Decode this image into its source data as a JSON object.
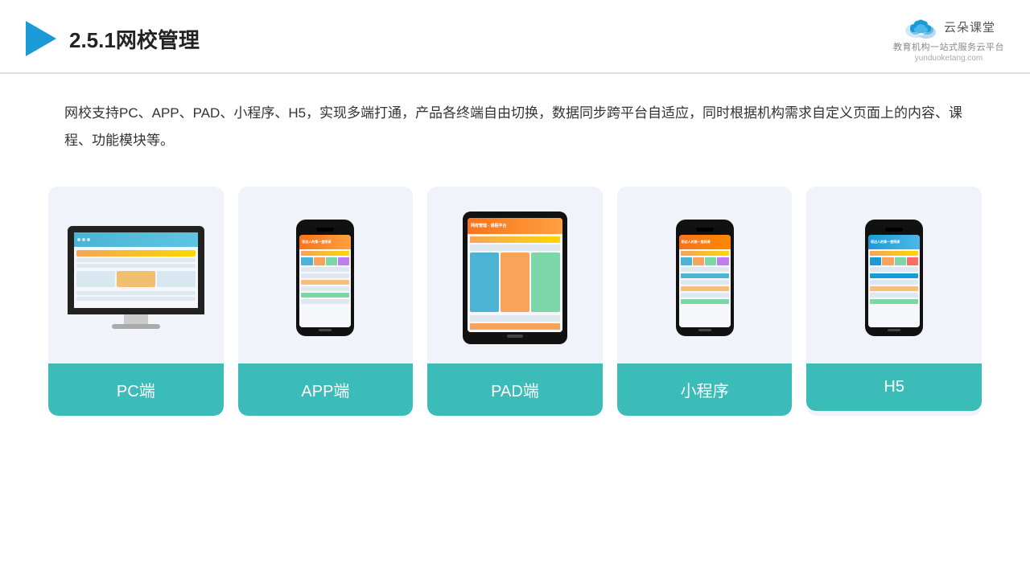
{
  "header": {
    "title": "2.5.1网校管理",
    "brand": {
      "name": "云朵课堂",
      "tagline": "教育机构一站式服务云平台",
      "url": "yunduoketang.com"
    }
  },
  "description": "网校支持PC、APP、PAD、小程序、H5，实现多端打通，产品各终端自由切换，数据同步跨平台自适应，同时根据机构需求自定义页面上的内容、课程、功能模块等。",
  "cards": [
    {
      "id": "pc",
      "label": "PC端",
      "type": "pc"
    },
    {
      "id": "app",
      "label": "APP端",
      "type": "phone"
    },
    {
      "id": "pad",
      "label": "PAD端",
      "type": "tablet"
    },
    {
      "id": "miniprogram",
      "label": "小程序",
      "type": "phone2"
    },
    {
      "id": "h5",
      "label": "H5",
      "type": "phone3"
    }
  ],
  "colors": {
    "card_label_bg": "#3bbcb8",
    "accent": "#1a9bd7"
  }
}
